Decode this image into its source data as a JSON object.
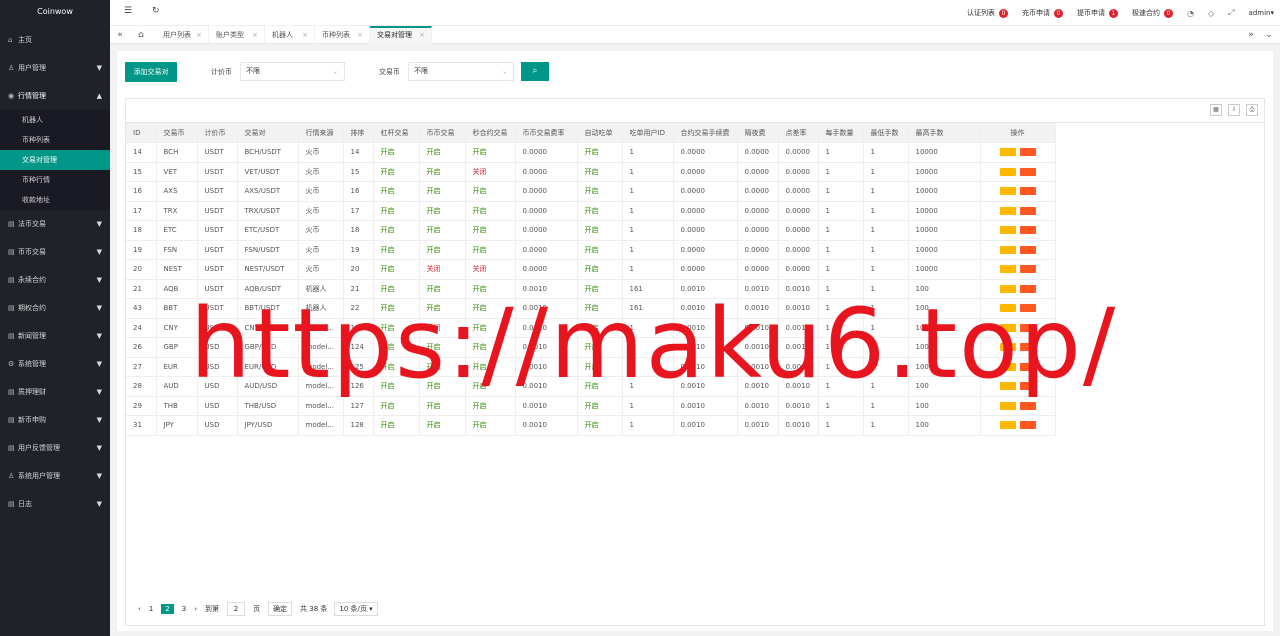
{
  "sidebar": {
    "logo": "Coinwow",
    "items": [
      {
        "label": "主页",
        "icon": "home-icon",
        "caret": false
      },
      {
        "label": "用户管理",
        "icon": "user-icon",
        "caret": true
      },
      {
        "label": "行情管理",
        "icon": "info-icon",
        "caret": true,
        "open": true,
        "children": [
          {
            "label": "机器人",
            "active": false
          },
          {
            "label": "币种列表",
            "active": false
          },
          {
            "label": "交易对管理",
            "active": true
          },
          {
            "label": "币种行情",
            "active": false
          },
          {
            "label": "收款地址",
            "active": false
          }
        ]
      },
      {
        "label": "法币交易",
        "icon": "list-icon",
        "caret": true
      },
      {
        "label": "币币交易",
        "icon": "list-icon",
        "caret": true
      },
      {
        "label": "永续合约",
        "icon": "list-icon",
        "caret": true
      },
      {
        "label": "期权合约",
        "icon": "list-icon",
        "caret": true
      },
      {
        "label": "新闻管理",
        "icon": "list-icon",
        "caret": true
      },
      {
        "label": "系统管理",
        "icon": "gear-icon",
        "caret": true
      },
      {
        "label": "质押理财",
        "icon": "list-icon",
        "caret": true
      },
      {
        "label": "新币申购",
        "icon": "list-icon",
        "caret": true
      },
      {
        "label": "用户反馈管理",
        "icon": "list-icon",
        "caret": true
      },
      {
        "label": "系统用户管理",
        "icon": "user-icon",
        "caret": true
      },
      {
        "label": "日志",
        "icon": "list-icon",
        "caret": true
      }
    ]
  },
  "header": {
    "links": [
      {
        "label": "认证列表",
        "count": "0"
      },
      {
        "label": "充币申请",
        "count": "0"
      },
      {
        "label": "提币申请",
        "count": "1"
      },
      {
        "label": "极速合约",
        "count": "0"
      }
    ],
    "user": "admin"
  },
  "tabs": [
    "用户列表",
    "账户类型",
    "机器人",
    "币种列表",
    "交易对管理"
  ],
  "filters": {
    "add_button": "添加交易对",
    "base_label": "计价币",
    "base_value": "不限",
    "quote_label": "交易币",
    "quote_value": "不限"
  },
  "table": {
    "columns": [
      "ID",
      "交易币",
      "计价币",
      "交易对",
      "行情来源",
      "排序",
      "杠杆交易",
      "币币交易",
      "秒合约交易",
      "币币交易费率",
      "自动吃单",
      "吃单用户ID",
      "合约交易手续费",
      "隔夜费",
      "点差率",
      "每手数量",
      "最低手数",
      "最高手数",
      "操作"
    ],
    "rows": [
      [
        "14",
        "BCH",
        "USDT",
        "BCH/USDT",
        "火币",
        "14",
        "开启",
        "开启",
        "开启",
        "0.0000",
        "开启",
        "1",
        "0.0000",
        "0.0000",
        "0.0000",
        "1",
        "1",
        "10000"
      ],
      [
        "15",
        "VET",
        "USDT",
        "VET/USDT",
        "火币",
        "15",
        "开启",
        "开启",
        "关闭",
        "0.0000",
        "开启",
        "1",
        "0.0000",
        "0.0000",
        "0.0000",
        "1",
        "1",
        "10000"
      ],
      [
        "16",
        "AXS",
        "USDT",
        "AXS/USDT",
        "火币",
        "16",
        "开启",
        "开启",
        "开启",
        "0.0000",
        "开启",
        "1",
        "0.0000",
        "0.0000",
        "0.0000",
        "1",
        "1",
        "10000"
      ],
      [
        "17",
        "TRX",
        "USDT",
        "TRX/USDT",
        "火币",
        "17",
        "开启",
        "开启",
        "开启",
        "0.0000",
        "开启",
        "1",
        "0.0000",
        "0.0000",
        "0.0000",
        "1",
        "1",
        "10000"
      ],
      [
        "18",
        "ETC",
        "USDT",
        "ETC/USDT",
        "火币",
        "18",
        "开启",
        "开启",
        "开启",
        "0.0000",
        "开启",
        "1",
        "0.0000",
        "0.0000",
        "0.0000",
        "1",
        "1",
        "10000"
      ],
      [
        "19",
        "FSN",
        "USDT",
        "FSN/USDT",
        "火币",
        "19",
        "开启",
        "开启",
        "开启",
        "0.0000",
        "开启",
        "1",
        "0.0000",
        "0.0000",
        "0.0000",
        "1",
        "1",
        "10000"
      ],
      [
        "20",
        "NEST",
        "USDT",
        "NEST/USDT",
        "火币",
        "20",
        "开启",
        "关闭",
        "关闭",
        "0.0000",
        "开启",
        "1",
        "0.0000",
        "0.0000",
        "0.0000",
        "1",
        "1",
        "10000"
      ],
      [
        "21",
        "AQB",
        "USDT",
        "AQB/USDT",
        "机器人",
        "21",
        "开启",
        "开启",
        "开启",
        "0.0010",
        "开启",
        "161",
        "0.0010",
        "0.0010",
        "0.0010",
        "1",
        "1",
        "100"
      ],
      [
        "43",
        "BBT",
        "USDT",
        "BBT/USDT",
        "机器人",
        "22",
        "开启",
        "开启",
        "开启",
        "0.0010",
        "开启",
        "161",
        "0.0010",
        "0.0010",
        "0.0010",
        "1",
        "1",
        "100"
      ],
      [
        "24",
        "CNY",
        "USD",
        "CNY/USD",
        "model...",
        "123",
        "开启",
        "关闭",
        "开启",
        "0.0010",
        "开启",
        "1",
        "0.0010",
        "0.0010",
        "0.0010",
        "1",
        "1",
        "100"
      ],
      [
        "26",
        "GBP",
        "USD",
        "GBP/USD",
        "model...",
        "124",
        "开启",
        "开启",
        "开启",
        "0.0010",
        "开启",
        "1",
        "0.0010",
        "0.0010",
        "0.0010",
        "1",
        "1",
        "100"
      ],
      [
        "27",
        "EUR",
        "USD",
        "EUR/USD",
        "model...",
        "125",
        "开启",
        "开启",
        "开启",
        "0.0010",
        "开启",
        "1",
        "0.0010",
        "0.0010",
        "0.0010",
        "1",
        "1",
        "100"
      ],
      [
        "28",
        "AUD",
        "USD",
        "AUD/USD",
        "model...",
        "126",
        "开启",
        "开启",
        "开启",
        "0.0010",
        "开启",
        "1",
        "0.0010",
        "0.0010",
        "0.0010",
        "1",
        "1",
        "100"
      ],
      [
        "29",
        "THB",
        "USD",
        "THB/USD",
        "model...",
        "127",
        "开启",
        "开启",
        "开启",
        "0.0010",
        "开启",
        "1",
        "0.0010",
        "0.0010",
        "0.0010",
        "1",
        "1",
        "100"
      ],
      [
        "31",
        "JPY",
        "USD",
        "JPY/USD",
        "model...",
        "128",
        "开启",
        "开启",
        "开启",
        "0.0010",
        "开启",
        "1",
        "0.0010",
        "0.0010",
        "0.0010",
        "1",
        "1",
        "100"
      ]
    ]
  },
  "pager": {
    "pages": [
      "1",
      "2",
      "3"
    ],
    "current": "2",
    "goto_label": "到第",
    "goto_value": "2",
    "page_unit": "页",
    "confirm": "确定",
    "total": "共 38 条",
    "per_page": "10 条/页"
  },
  "watermark": "https://maku6.top/"
}
